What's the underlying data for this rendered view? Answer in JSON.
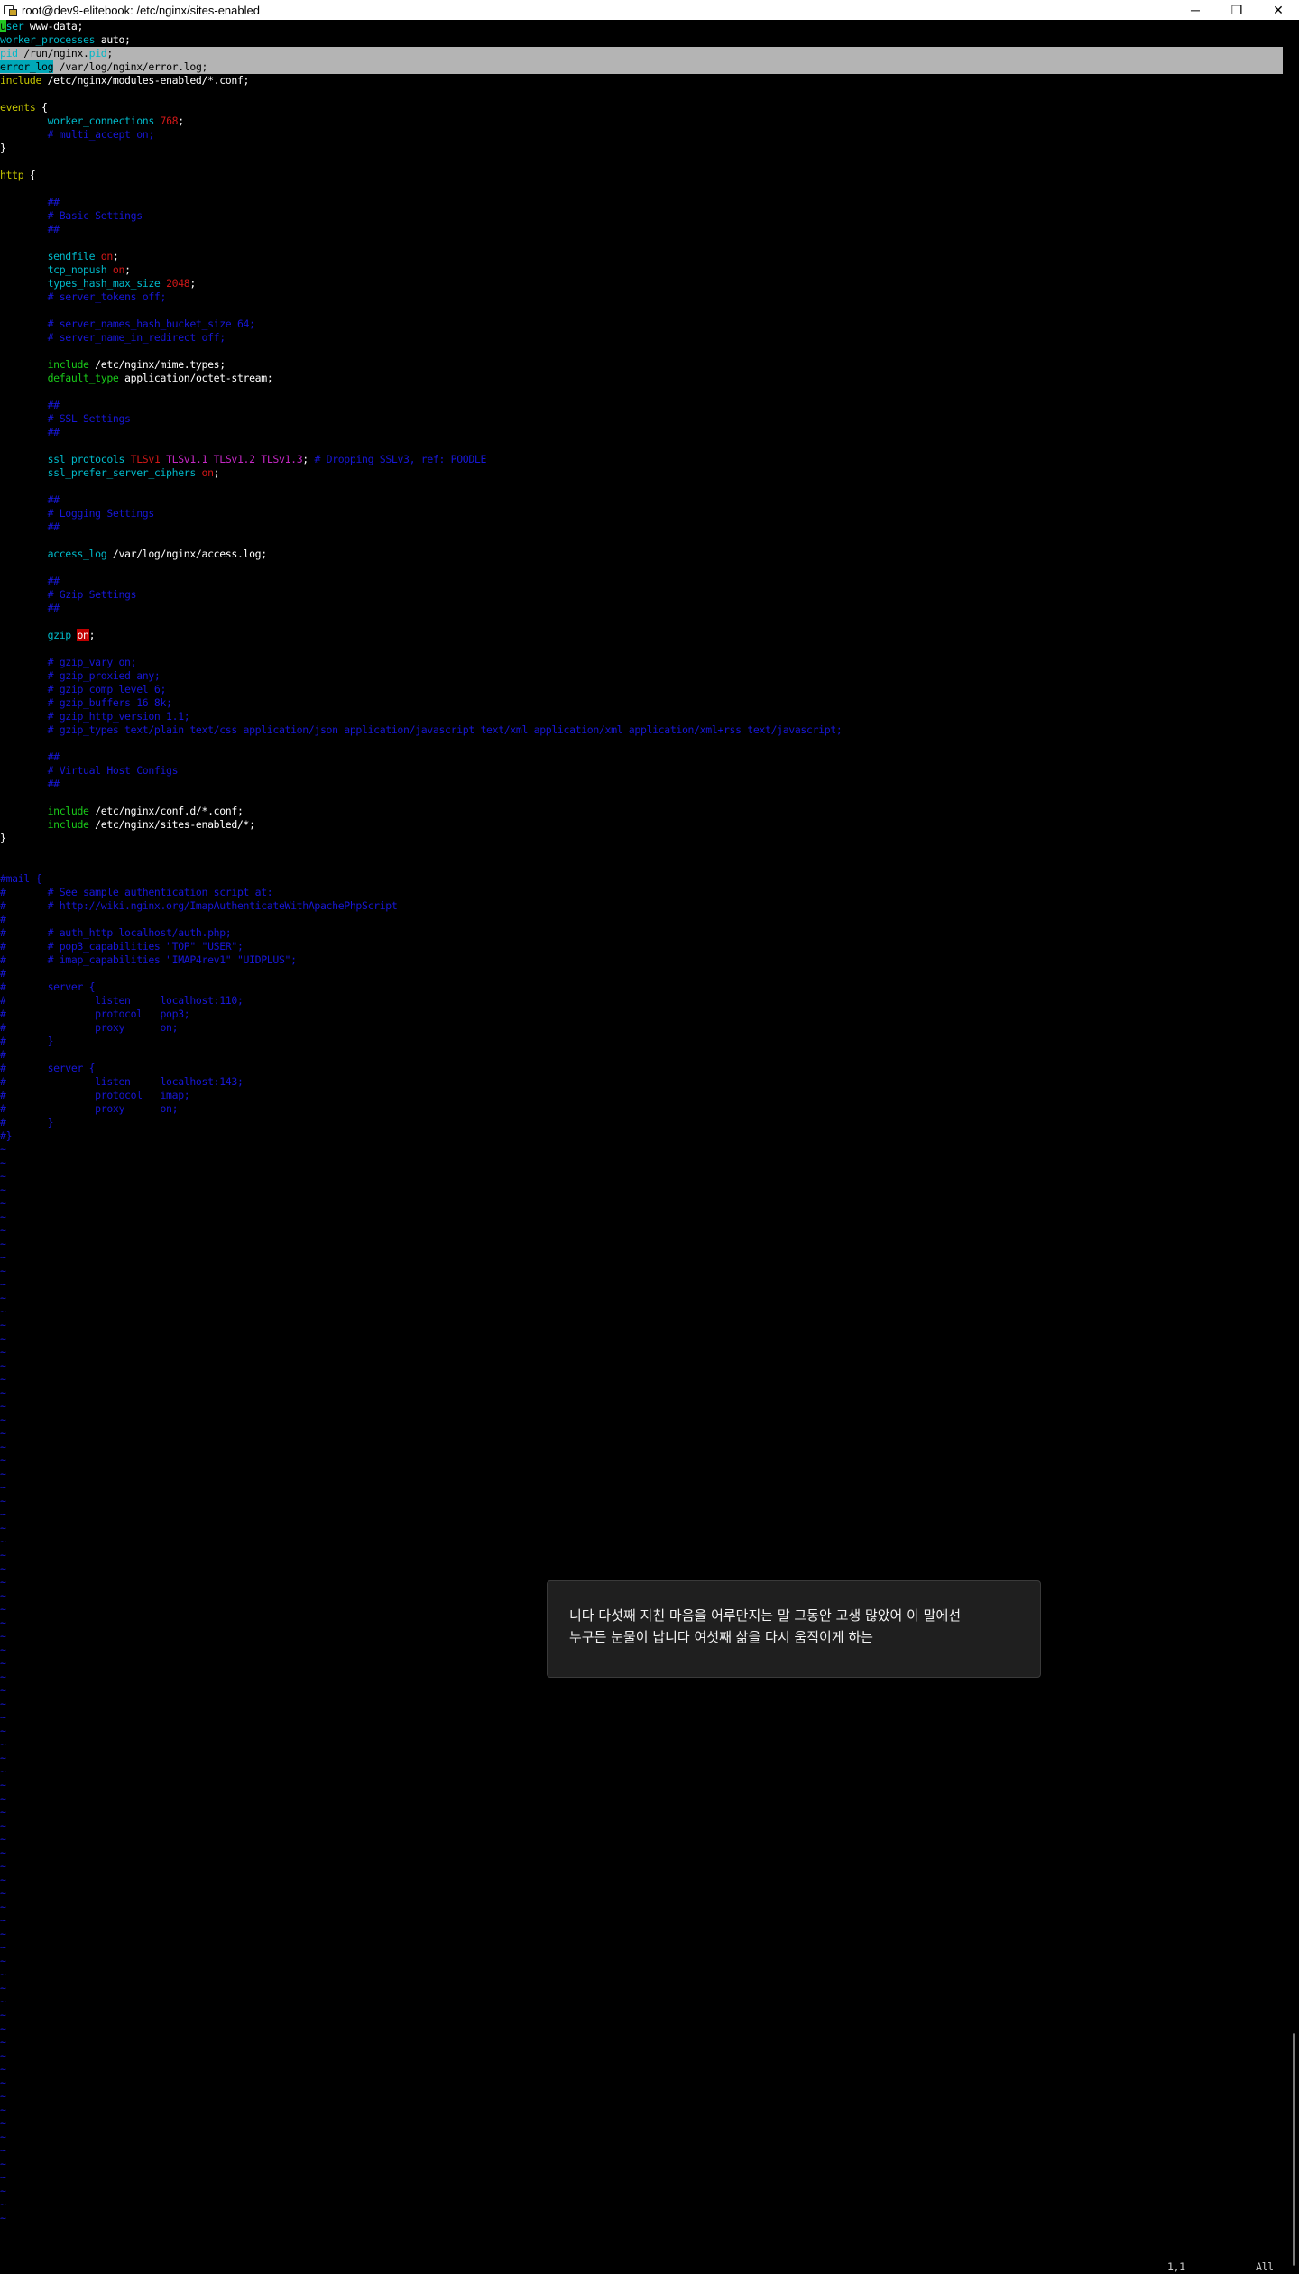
{
  "window": {
    "title": "root@dev9-elitebook: /etc/nginx/sites-enabled",
    "minimize": "─",
    "restore": "❐",
    "close": "✕"
  },
  "editor": {
    "lines": [
      [
        {
          "t": "u",
          "c": "cursor"
        },
        {
          "t": "ser",
          "c": "kw-c"
        },
        {
          "t": " www-data;",
          "c": "wht"
        }
      ],
      [
        {
          "t": "worker_processes",
          "c": "kw-c"
        },
        {
          "t": " auto;",
          "c": "wht"
        }
      ],
      {
        "hl": true,
        "seg": [
          {
            "t": "pid",
            "c": "kw-c"
          },
          {
            "t": " /run/nginx.",
            "c": "blk"
          },
          {
            "t": "pid",
            "c": "kw-c"
          },
          {
            "t": ";",
            "c": "blk"
          }
        ]
      },
      {
        "hl": true,
        "seg": [
          {
            "t": "error_log",
            "c": "sel-cyan"
          },
          {
            "t": " /var/log/nginx/error.log;",
            "c": "blk"
          }
        ]
      },
      [
        {
          "t": "include",
          "c": "kw-y"
        },
        {
          "t": " /etc/nginx/modules-enabled/*.conf;",
          "c": "wht"
        }
      ],
      [],
      [
        {
          "t": "events",
          "c": "kw-y"
        },
        {
          "t": " {",
          "c": "wht"
        }
      ],
      [
        {
          "t": "        worker_connections",
          "c": "kw-c"
        },
        {
          "t": " ",
          "c": "wht"
        },
        {
          "t": "768",
          "c": "val-r"
        },
        {
          "t": ";",
          "c": "wht"
        }
      ],
      [
        {
          "t": "        # multi_accept on;",
          "c": "cmt"
        }
      ],
      [
        {
          "t": "}",
          "c": "wht"
        }
      ],
      [],
      [
        {
          "t": "http",
          "c": "kw-y"
        },
        {
          "t": " {",
          "c": "wht"
        }
      ],
      [],
      [
        {
          "t": "        ##",
          "c": "cmt"
        }
      ],
      [
        {
          "t": "        # Basic Settings",
          "c": "cmt"
        }
      ],
      [
        {
          "t": "        ##",
          "c": "cmt"
        }
      ],
      [],
      [
        {
          "t": "        sendfile",
          "c": "kw-c"
        },
        {
          "t": " ",
          "c": "wht"
        },
        {
          "t": "on",
          "c": "val-r"
        },
        {
          "t": ";",
          "c": "wht"
        }
      ],
      [
        {
          "t": "        tcp_nopush",
          "c": "kw-c"
        },
        {
          "t": " ",
          "c": "wht"
        },
        {
          "t": "on",
          "c": "val-r"
        },
        {
          "t": ";",
          "c": "wht"
        }
      ],
      [
        {
          "t": "        types_hash_max_size",
          "c": "kw-c"
        },
        {
          "t": " ",
          "c": "wht"
        },
        {
          "t": "2048",
          "c": "val-r"
        },
        {
          "t": ";",
          "c": "wht"
        }
      ],
      [
        {
          "t": "        # server_tokens off;",
          "c": "cmt"
        }
      ],
      [],
      [
        {
          "t": "        # server_names_hash_bucket_size 64;",
          "c": "cmt"
        }
      ],
      [
        {
          "t": "        # server_name_in_redirect off;",
          "c": "cmt"
        }
      ],
      [],
      [
        {
          "t": "        include",
          "c": "kw-g"
        },
        {
          "t": " /etc/nginx/mime.types;",
          "c": "wht"
        }
      ],
      [
        {
          "t": "        default_type",
          "c": "kw-g"
        },
        {
          "t": " application/octet-stream;",
          "c": "wht"
        }
      ],
      [],
      [
        {
          "t": "        ##",
          "c": "cmt"
        }
      ],
      [
        {
          "t": "        # SSL Settings",
          "c": "cmt"
        }
      ],
      [
        {
          "t": "        ##",
          "c": "cmt"
        }
      ],
      [],
      [
        {
          "t": "        ssl_protocols",
          "c": "kw-c"
        },
        {
          "t": " ",
          "c": "wht"
        },
        {
          "t": "TLSv1",
          "c": "val-r"
        },
        {
          "t": " ",
          "c": "wht"
        },
        {
          "t": "TLSv1.1",
          "c": "val-m"
        },
        {
          "t": " ",
          "c": "wht"
        },
        {
          "t": "TLSv1.2",
          "c": "val-m"
        },
        {
          "t": " ",
          "c": "wht"
        },
        {
          "t": "TLSv1.3",
          "c": "val-m"
        },
        {
          "t": "; ",
          "c": "wht"
        },
        {
          "t": "# Dropping SSLv3, ref: POODLE",
          "c": "cmt"
        }
      ],
      [
        {
          "t": "        ssl_prefer_server_ciphers",
          "c": "kw-c"
        },
        {
          "t": " ",
          "c": "wht"
        },
        {
          "t": "on",
          "c": "val-r"
        },
        {
          "t": ";",
          "c": "wht"
        }
      ],
      [],
      [
        {
          "t": "        ##",
          "c": "cmt"
        }
      ],
      [
        {
          "t": "        # Logging Settings",
          "c": "cmt"
        }
      ],
      [
        {
          "t": "        ##",
          "c": "cmt"
        }
      ],
      [],
      [
        {
          "t": "        access_log",
          "c": "kw-c"
        },
        {
          "t": " /var/log/nginx/access.log;",
          "c": "wht"
        }
      ],
      [],
      [
        {
          "t": "        ##",
          "c": "cmt"
        }
      ],
      [
        {
          "t": "        # Gzip Settings",
          "c": "cmt"
        }
      ],
      [
        {
          "t": "        ##",
          "c": "cmt"
        }
      ],
      [],
      [
        {
          "t": "        gzip",
          "c": "kw-c"
        },
        {
          "t": " ",
          "c": "wht"
        },
        {
          "t": "on",
          "c": "err"
        },
        {
          "t": ";",
          "c": "wht"
        }
      ],
      [],
      [
        {
          "t": "        # gzip_vary on;",
          "c": "cmt"
        }
      ],
      [
        {
          "t": "        # gzip_proxied any;",
          "c": "cmt"
        }
      ],
      [
        {
          "t": "        # gzip_comp_level 6;",
          "c": "cmt"
        }
      ],
      [
        {
          "t": "        # gzip_buffers 16 8k;",
          "c": "cmt"
        }
      ],
      [
        {
          "t": "        # gzip_http_version 1.1;",
          "c": "cmt"
        }
      ],
      [
        {
          "t": "        # gzip_types text/plain text/css application/json application/javascript text/xml application/xml application/xml+rss text/javascript;",
          "c": "cmt"
        }
      ],
      [],
      [
        {
          "t": "        ##",
          "c": "cmt"
        }
      ],
      [
        {
          "t": "        # Virtual Host Configs",
          "c": "cmt"
        }
      ],
      [
        {
          "t": "        ##",
          "c": "cmt"
        }
      ],
      [],
      [
        {
          "t": "        include",
          "c": "kw-g"
        },
        {
          "t": " /etc/nginx/conf.d/*.conf;",
          "c": "wht"
        }
      ],
      [
        {
          "t": "        include",
          "c": "kw-g"
        },
        {
          "t": " /etc/nginx/sites-enabled/*;",
          "c": "wht"
        }
      ],
      [
        {
          "t": "}",
          "c": "wht"
        }
      ],
      [],
      [],
      [
        {
          "t": "#mail {",
          "c": "cmt"
        }
      ],
      [
        {
          "t": "#       # See sample authentication script at:",
          "c": "cmt"
        }
      ],
      [
        {
          "t": "#       # http://wiki.nginx.org/ImapAuthenticateWithApachePhpScript",
          "c": "cmt"
        }
      ],
      [
        {
          "t": "#",
          "c": "cmt"
        }
      ],
      [
        {
          "t": "#       # auth_http localhost/auth.php;",
          "c": "cmt"
        }
      ],
      [
        {
          "t": "#       # pop3_capabilities \"TOP\" \"USER\";",
          "c": "cmt"
        }
      ],
      [
        {
          "t": "#       # imap_capabilities \"IMAP4rev1\" \"UIDPLUS\";",
          "c": "cmt"
        }
      ],
      [
        {
          "t": "#",
          "c": "cmt"
        }
      ],
      [
        {
          "t": "#       server {",
          "c": "cmt"
        }
      ],
      [
        {
          "t": "#               listen     localhost:110;",
          "c": "cmt"
        }
      ],
      [
        {
          "t": "#               protocol   pop3;",
          "c": "cmt"
        }
      ],
      [
        {
          "t": "#               proxy      on;",
          "c": "cmt"
        }
      ],
      [
        {
          "t": "#       }",
          "c": "cmt"
        }
      ],
      [
        {
          "t": "#",
          "c": "cmt"
        }
      ],
      [
        {
          "t": "#       server {",
          "c": "cmt"
        }
      ],
      [
        {
          "t": "#               listen     localhost:143;",
          "c": "cmt"
        }
      ],
      [
        {
          "t": "#               protocol   imap;",
          "c": "cmt"
        }
      ],
      [
        {
          "t": "#               proxy      on;",
          "c": "cmt"
        }
      ],
      [
        {
          "t": "#       }",
          "c": "cmt"
        }
      ],
      [
        {
          "t": "#}",
          "c": "cmt"
        }
      ]
    ],
    "tilde_char": "~",
    "tilde_count": 80
  },
  "status": {
    "position": "1,1",
    "scroll": "All"
  },
  "notification": {
    "line1": "니다 다섯째 지친 마음을 어루만지는 말 그동안 고생 많았어 이 말에선",
    "line2": "누구든 눈물이 납니다 여섯째 삶을 다시 움직이게 하는"
  }
}
